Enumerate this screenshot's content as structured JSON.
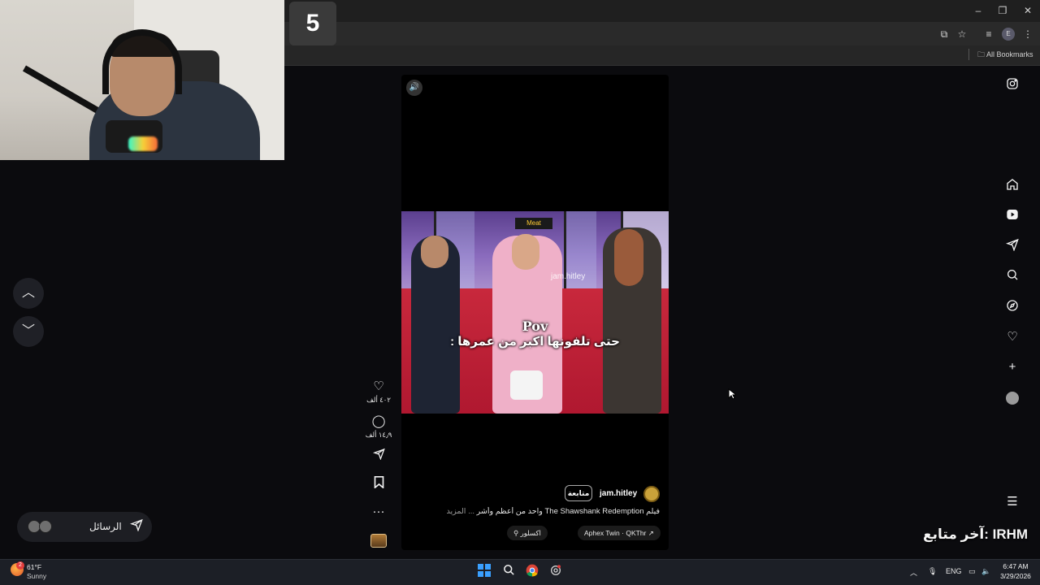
{
  "browser": {
    "tab_number_badge": "5",
    "bookmarks_label": "All Bookmarks",
    "window_controls": [
      "minimize-icon",
      "restore-icon",
      "close-icon"
    ],
    "toolbar_icons": [
      "install-app-icon",
      "star-icon",
      "media-icon",
      "profile-icon",
      "more-vert-icon"
    ]
  },
  "left_nav": {
    "up_icon": "chevron-up-icon",
    "down_icon": "chevron-down-icon"
  },
  "messages": {
    "label": "الرسائل",
    "icon": "send-icon"
  },
  "reel": {
    "mute_icon": "speaker-icon",
    "overlay_title": "Pov",
    "overlay_subtitle": "حتى تلفونها اكبر من عمرها :",
    "watermark": "jam.hitley",
    "sign_text": "Meat",
    "author": "jam.hitley",
    "follow_label": "متابعة",
    "caption": "فيلم The Shawshank Redemption واحد من أعظم وأشر",
    "caption_more": "... المزيد",
    "audio_chip": "Aphex Twin · QKThr ↗",
    "location_chip": "اكسلور"
  },
  "actions": {
    "likes": "٤٠٢ ألف",
    "comments": "١٤٫٩ ألف"
  },
  "sidebar": {
    "icons": [
      "instagram-icon",
      "home-icon",
      "reels-icon",
      "send-icon",
      "search-icon",
      "explore-icon",
      "heart-icon",
      "plus-icon",
      "profile-avatar",
      "menu-icon"
    ]
  },
  "stream_overlay": {
    "text": "آخر متابع: IRHM"
  },
  "taskbar": {
    "temp": "61°F",
    "condition": "Sunny",
    "weather_badge": "2",
    "lang": "ENG",
    "time": "6:47 AM",
    "date": "3/29/2026"
  },
  "colors": {
    "page_bg": "#0b0b0e",
    "reel_bg": "#000000",
    "taskbar_bg": "#1c1f26"
  }
}
